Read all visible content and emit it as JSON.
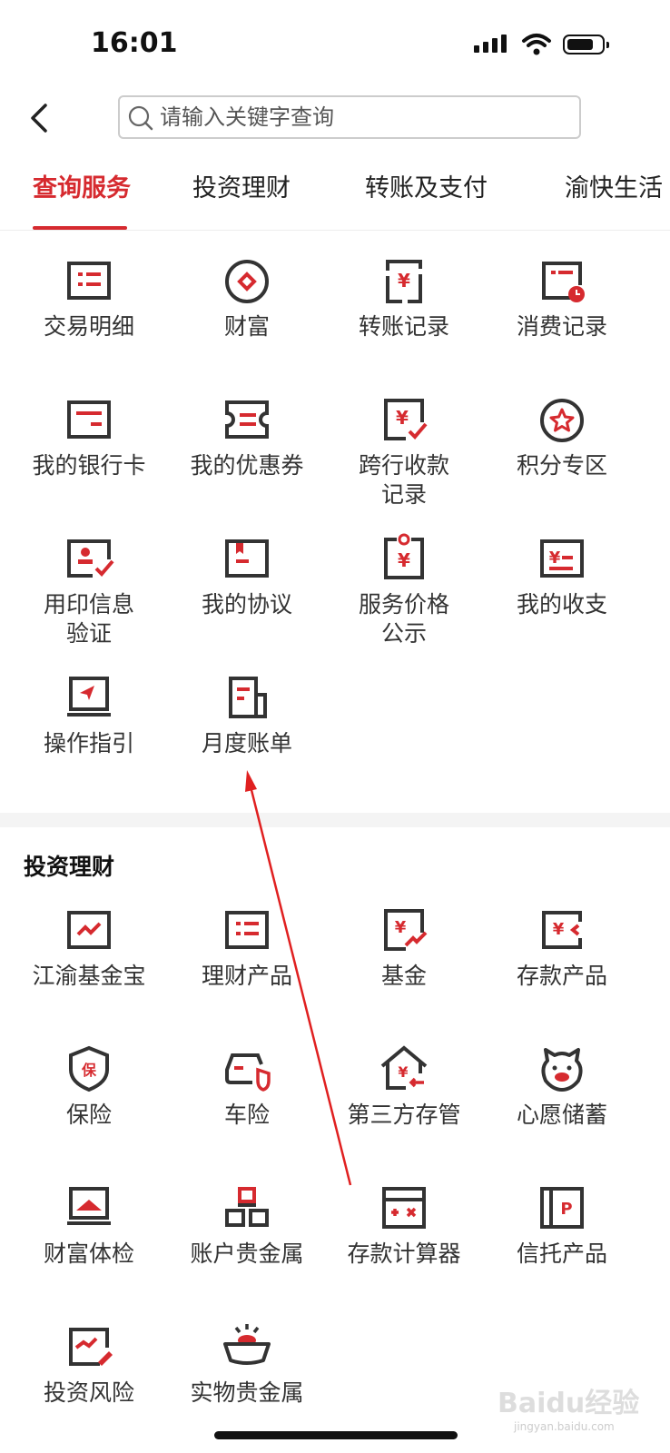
{
  "status_bar": {
    "time": "16:01"
  },
  "search": {
    "placeholder": "请输入关键字查询"
  },
  "tabs": [
    {
      "label": "查询服务",
      "active": true
    },
    {
      "label": "投资理财",
      "active": false
    },
    {
      "label": "转账及支付",
      "active": false
    },
    {
      "label": "渝快生活",
      "active": false
    }
  ],
  "query_services": [
    {
      "label": "交易明细",
      "icon": "list-icon"
    },
    {
      "label": "财富",
      "icon": "wealth-icon"
    },
    {
      "label": "转账记录",
      "icon": "transfer-record-icon"
    },
    {
      "label": "消费记录",
      "icon": "consumption-record-icon"
    },
    {
      "label": "我的银行卡",
      "icon": "bank-card-icon"
    },
    {
      "label": "我的优惠券",
      "icon": "coupon-icon"
    },
    {
      "label": "跨行收款记录",
      "icon": "interbank-receipt-icon"
    },
    {
      "label": "积分专区",
      "icon": "points-star-icon"
    },
    {
      "label": "用印信息验证",
      "icon": "seal-verify-icon"
    },
    {
      "label": "我的协议",
      "icon": "agreement-icon"
    },
    {
      "label": "服务价格公示",
      "icon": "service-price-icon"
    },
    {
      "label": "我的收支",
      "icon": "income-expense-icon"
    },
    {
      "label": "操作指引",
      "icon": "guide-icon"
    },
    {
      "label": "月度账单",
      "icon": "monthly-bill-icon"
    }
  ],
  "investment": {
    "title": "投资理财",
    "items": [
      {
        "label": "江渝基金宝",
        "icon": "fund-treasure-icon"
      },
      {
        "label": "理财产品",
        "icon": "wealth-product-icon"
      },
      {
        "label": "基金",
        "icon": "fund-icon"
      },
      {
        "label": "存款产品",
        "icon": "deposit-product-icon"
      },
      {
        "label": "保险",
        "icon": "insurance-shield-icon"
      },
      {
        "label": "车险",
        "icon": "car-insurance-icon"
      },
      {
        "label": "第三方存管",
        "icon": "third-party-depository-icon"
      },
      {
        "label": "心愿储蓄",
        "icon": "piggy-bank-icon"
      },
      {
        "label": "财富体检",
        "icon": "wealth-checkup-icon"
      },
      {
        "label": "账户贵金属",
        "icon": "account-precious-metal-icon"
      },
      {
        "label": "存款计算器",
        "icon": "deposit-calculator-icon"
      },
      {
        "label": "信托产品",
        "icon": "trust-product-icon"
      },
      {
        "label": "投资风险",
        "icon": "investment-risk-icon"
      },
      {
        "label": "实物贵金属",
        "icon": "physical-gold-icon"
      }
    ]
  },
  "colors": {
    "accent": "#d62a2f",
    "icon_dark": "#333333"
  }
}
